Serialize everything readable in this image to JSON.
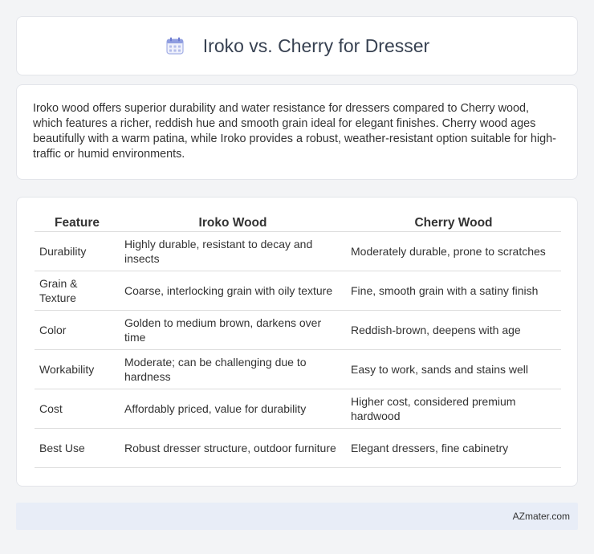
{
  "header": {
    "title": "Iroko vs. Cherry for Dresser",
    "icon": "calendar-icon"
  },
  "intro": {
    "text": "Iroko wood offers superior durability and water resistance for dressers compared to Cherry wood, which features a richer, reddish hue and smooth grain ideal for elegant finishes. Cherry wood ages beautifully with a warm patina, while Iroko provides a robust, weather-resistant option suitable for high-traffic or humid environments."
  },
  "table": {
    "headers": [
      "Feature",
      "Iroko Wood",
      "Cherry Wood"
    ],
    "rows": [
      [
        "Durability",
        "Highly durable, resistant to decay and insects",
        "Moderately durable, prone to scratches"
      ],
      [
        "Grain & Texture",
        "Coarse, interlocking grain with oily texture",
        "Fine, smooth grain with a satiny finish"
      ],
      [
        "Color",
        "Golden to medium brown, darkens over time",
        "Reddish-brown, deepens with age"
      ],
      [
        "Workability",
        "Moderate; can be challenging due to hardness",
        "Easy to work, sands and stains well"
      ],
      [
        "Cost",
        "Affordably priced, value for durability",
        "Higher cost, considered premium hardwood"
      ],
      [
        "Best Use",
        "Robust dresser structure, outdoor furniture",
        "Elegant dressers, fine cabinetry"
      ]
    ]
  },
  "footer": {
    "text": "AZmater.com"
  }
}
